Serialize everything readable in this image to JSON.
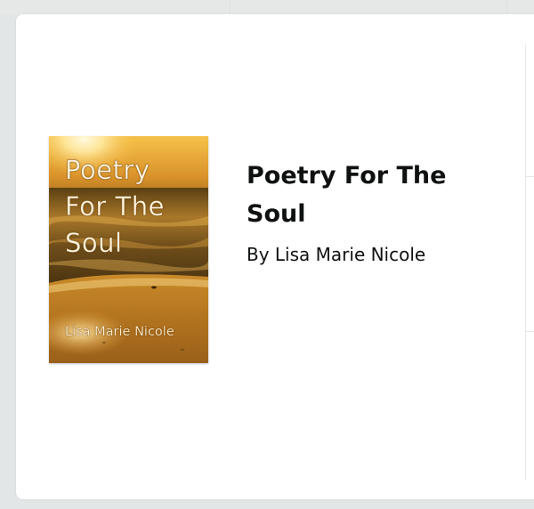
{
  "book": {
    "cover": {
      "title_lines": [
        "Poetry",
        "For The",
        "Soul"
      ],
      "author": "Lisa Marie Nicole",
      "image_name": "sunset-beach-cover"
    },
    "title": "Poetry For The Soul",
    "author_line": "By Lisa Marie Nicole"
  },
  "colors": {
    "page_background": "#e3e6e6",
    "card_background": "#ffffff",
    "text": "#0f1111"
  }
}
